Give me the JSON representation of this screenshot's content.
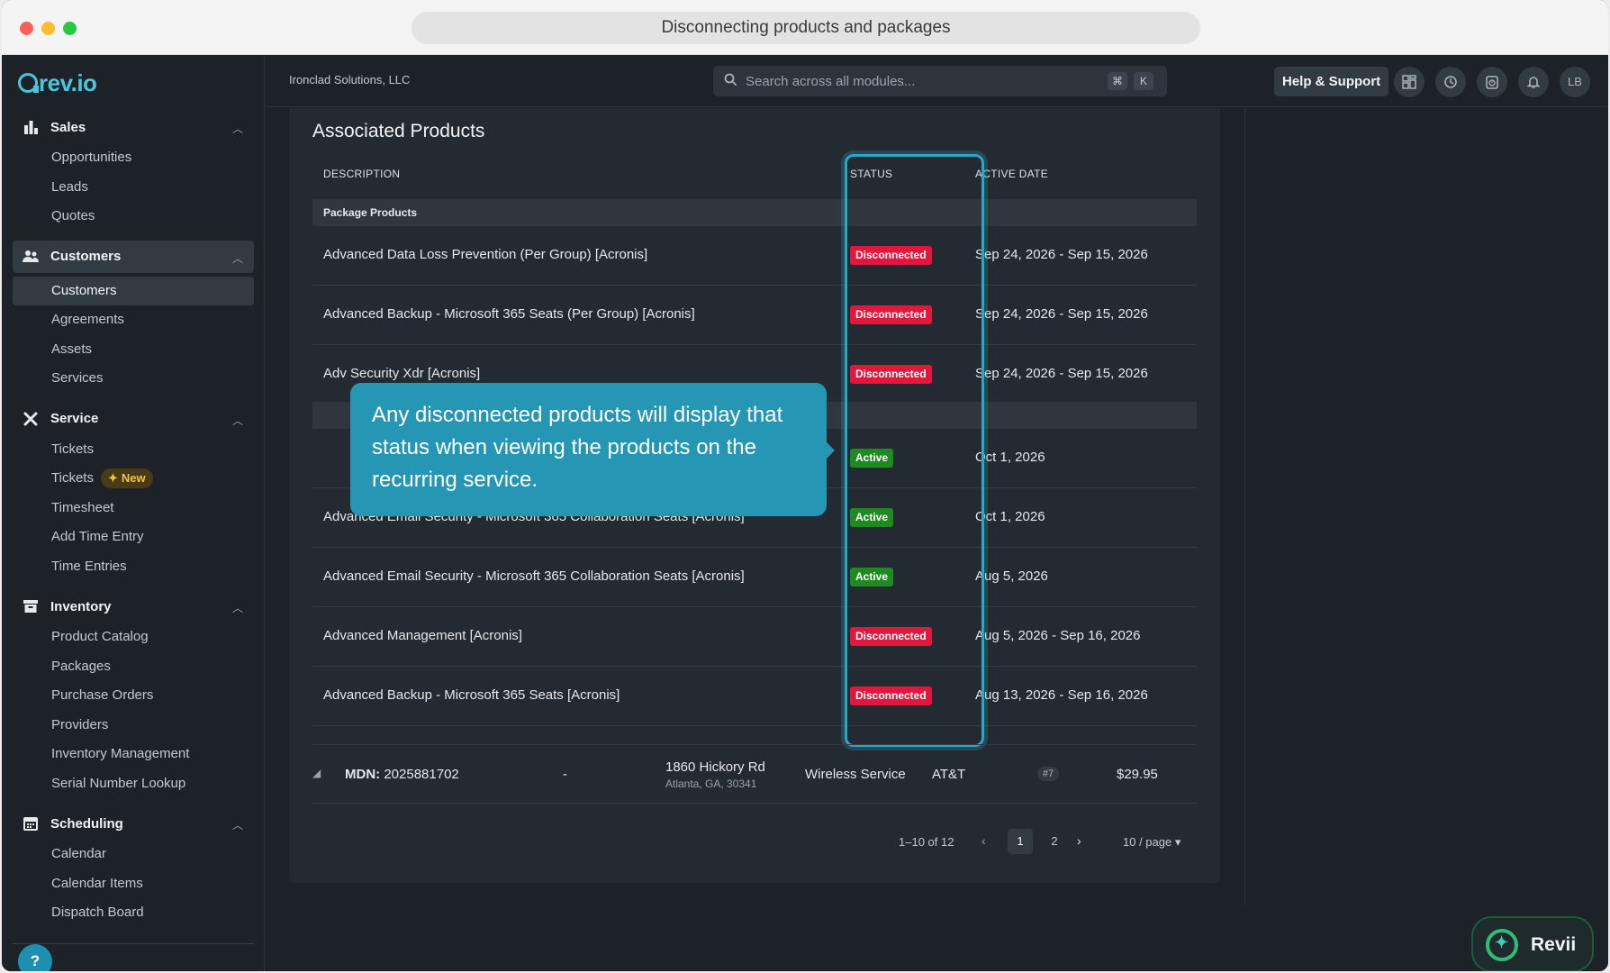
{
  "window": {
    "title": "Disconnecting products and packages"
  },
  "sidebar": {
    "logo": "rev.io",
    "sections": [
      {
        "label": "Sales",
        "icon": "bar-chart-icon",
        "items": [
          "Opportunities",
          "Leads",
          "Quotes"
        ]
      },
      {
        "label": "Customers",
        "icon": "people-icon",
        "items": [
          "Customers",
          "Agreements",
          "Assets",
          "Services"
        ]
      },
      {
        "label": "Service",
        "icon": "tools-icon",
        "items": [
          "Tickets",
          "Tickets",
          "Timesheet",
          "Add Time Entry",
          "Time Entries"
        ],
        "new_badge": "New"
      },
      {
        "label": "Inventory",
        "icon": "box-icon",
        "items": [
          "Product Catalog",
          "Packages",
          "Purchase Orders",
          "Providers",
          "Inventory Management",
          "Serial Number Lookup"
        ]
      },
      {
        "label": "Scheduling",
        "icon": "calendar-icon",
        "items": [
          "Calendar",
          "Calendar Items",
          "Dispatch Board"
        ]
      }
    ],
    "help": "?"
  },
  "topbar": {
    "company": "Ironclad Solutions, LLC",
    "search_placeholder": "Search across all modules...",
    "kbd_cmd": "⌘",
    "kbd_k": "K",
    "help_label": "Help & Support",
    "avatar": "LB"
  },
  "products": {
    "title": "Associated Products",
    "columns": {
      "description": "DESCRIPTION",
      "status": "STATUS",
      "active_date": "ACTIVE DATE"
    },
    "group_label": "Package Products",
    "rows": [
      {
        "desc": "Advanced Data Loss Prevention (Per Group) [Acronis]",
        "status": "Disconnected",
        "date": "Sep 24, 2026 - Sep 15, 2026"
      },
      {
        "desc": "Advanced Backup - Microsoft 365 Seats (Per Group) [Acronis]",
        "status": "Disconnected",
        "date": "Sep 24, 2026 - Sep 15, 2026"
      },
      {
        "desc": "Adv Security Xdr [Acronis]",
        "status": "Disconnected",
        "date": "Sep 24, 2026 - Sep 15, 2026"
      },
      {
        "desc": "",
        "status": "Active",
        "date": "Oct 1, 2026"
      },
      {
        "desc": "Advanced Email Security - Microsoft 365 Collaboration Seats [Acronis]",
        "status": "Active",
        "date": "Oct 1, 2026"
      },
      {
        "desc": "Advanced Email Security - Microsoft 365 Collaboration Seats [Acronis]",
        "status": "Active",
        "date": "Aug 5, 2026"
      },
      {
        "desc": "Advanced Management [Acronis]",
        "status": "Disconnected",
        "date": "Aug 5, 2026 - Sep 16, 2026"
      },
      {
        "desc": "Advanced Backup - Microsoft 365 Seats [Acronis]",
        "status": "Disconnected",
        "date": "Aug 13, 2026 - Sep 16, 2026"
      }
    ]
  },
  "tooltip": "Any disconnected products will display that status when viewing the products on the recurring service.",
  "service_row": {
    "mdn_label": "MDN:",
    "mdn": "2025881702",
    "dash": "-",
    "address_line1": "1860 Hickory Rd",
    "address_line2": "Atlanta, GA, 30341",
    "service": "Wireless Service",
    "carrier": "AT&T",
    "tag": "#7",
    "price": "$29.95"
  },
  "pagination": {
    "range": "1–10 of 12",
    "current": "1",
    "next_page": "2",
    "per_page": "10 / page"
  },
  "assistant": {
    "label": "Revii"
  },
  "colors": {
    "accent": "#2aa7c7",
    "disconnected": "#e2173b",
    "active": "#1f8a1f"
  }
}
